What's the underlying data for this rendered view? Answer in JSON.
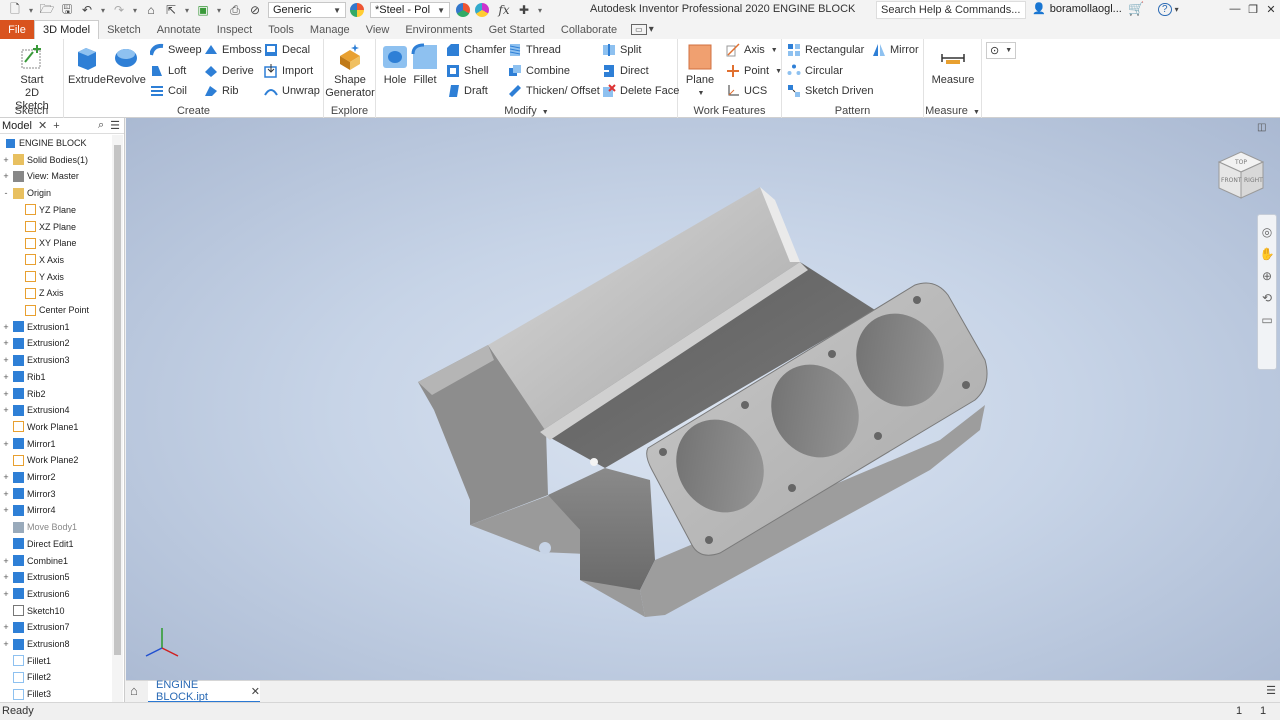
{
  "titlebar": {
    "appearance_dropdown": "Generic",
    "material_dropdown": "*Steel - Pol",
    "fx_label": "fx",
    "app_title": "Autodesk Inventor Professional 2020   ENGINE BLOCK",
    "search_label": "Search Help & Commands...",
    "user_name": "boramollaogl...",
    "help_label": "?"
  },
  "tabs": [
    "File",
    "3D Model",
    "Sketch",
    "Annotate",
    "Inspect",
    "Tools",
    "Manage",
    "View",
    "Environments",
    "Get Started",
    "Collaborate"
  ],
  "active_tab": "3D Model",
  "ribbon": {
    "sketch": {
      "start_sketch": "Start\n2D Sketch",
      "start_line1": "Start",
      "start_line2": "2D Sketch",
      "label": "Sketch"
    },
    "create": {
      "extrude": "Extrude",
      "revolve": "Revolve",
      "sweep": "Sweep",
      "emboss": "Emboss",
      "decal": "Decal",
      "loft": "Loft",
      "derive": "Derive",
      "import": "Import",
      "coil": "Coil",
      "rib": "Rib",
      "unwrap": "Unwrap",
      "label": "Create"
    },
    "explore": {
      "shape_line1": "Shape",
      "shape_line2": "Generator",
      "label": "Explore"
    },
    "modify": {
      "hole": "Hole",
      "fillet": "Fillet",
      "chamfer": "Chamfer",
      "thread": "Thread",
      "split": "Split",
      "shell": "Shell",
      "combine": "Combine",
      "direct": "Direct",
      "draft": "Draft",
      "thicken": "Thicken/ Offset",
      "delete_face": "Delete Face",
      "label": "Modify"
    },
    "work_features": {
      "plane": "Plane",
      "axis": "Axis",
      "point": "Point",
      "ucs": "UCS",
      "label": "Work Features"
    },
    "pattern": {
      "rectangular": "Rectangular",
      "mirror": "Mirror",
      "circular": "Circular",
      "sketch_driven": "Sketch Driven",
      "label": "Pattern"
    },
    "measure": {
      "measure": "Measure",
      "label": "Measure"
    }
  },
  "browser": {
    "title": "Model",
    "close": "✕",
    "add": "+",
    "root": "ENGINE BLOCK",
    "nodes": [
      {
        "label": "Solid Bodies(1)",
        "toggle": "+",
        "icon": "folder"
      },
      {
        "label": "View: Master",
        "toggle": "+",
        "icon": "view"
      },
      {
        "label": "Origin",
        "toggle": "-",
        "icon": "folder"
      },
      {
        "label": "YZ Plane",
        "toggle": "",
        "icon": "plane",
        "child": true
      },
      {
        "label": "XZ Plane",
        "toggle": "",
        "icon": "plane",
        "child": true
      },
      {
        "label": "XY Plane",
        "toggle": "",
        "icon": "plane",
        "child": true
      },
      {
        "label": "X Axis",
        "toggle": "",
        "icon": "axis",
        "child": true
      },
      {
        "label": "Y Axis",
        "toggle": "",
        "icon": "axis",
        "child": true
      },
      {
        "label": "Z Axis",
        "toggle": "",
        "icon": "axis",
        "child": true
      },
      {
        "label": "Center Point",
        "toggle": "",
        "icon": "point",
        "child": true
      },
      {
        "label": "Extrusion1",
        "toggle": "+",
        "icon": "extrude"
      },
      {
        "label": "Extrusion2",
        "toggle": "+",
        "icon": "extrude"
      },
      {
        "label": "Extrusion3",
        "toggle": "+",
        "icon": "extrude"
      },
      {
        "label": "Rib1",
        "toggle": "+",
        "icon": "rib"
      },
      {
        "label": "Rib2",
        "toggle": "+",
        "icon": "rib"
      },
      {
        "label": "Extrusion4",
        "toggle": "+",
        "icon": "extrude"
      },
      {
        "label": "Work Plane1",
        "toggle": "",
        "icon": "plane"
      },
      {
        "label": "Mirror1",
        "toggle": "+",
        "icon": "mirror"
      },
      {
        "label": "Work Plane2",
        "toggle": "",
        "icon": "plane"
      },
      {
        "label": "Mirror2",
        "toggle": "+",
        "icon": "mirror"
      },
      {
        "label": "Mirror3",
        "toggle": "+",
        "icon": "mirror"
      },
      {
        "label": "Mirror4",
        "toggle": "+",
        "icon": "mirror"
      },
      {
        "label": "Move Body1",
        "toggle": "",
        "icon": "move",
        "muted": true
      },
      {
        "label": "Direct Edit1",
        "toggle": "",
        "icon": "direct"
      },
      {
        "label": "Combine1",
        "toggle": "+",
        "icon": "combine"
      },
      {
        "label": "Extrusion5",
        "toggle": "+",
        "icon": "extrude"
      },
      {
        "label": "Extrusion6",
        "toggle": "+",
        "icon": "extrude"
      },
      {
        "label": "Sketch10",
        "toggle": "",
        "icon": "sketch"
      },
      {
        "label": "Extrusion7",
        "toggle": "+",
        "icon": "extrude"
      },
      {
        "label": "Extrusion8",
        "toggle": "+",
        "icon": "extrude"
      },
      {
        "label": "Fillet1",
        "toggle": "",
        "icon": "fillet"
      },
      {
        "label": "Fillet2",
        "toggle": "",
        "icon": "fillet"
      },
      {
        "label": "Fillet3",
        "toggle": "",
        "icon": "fillet"
      }
    ]
  },
  "viewcube": {
    "top": "TOP",
    "front": "FRONT",
    "right": "RIGHT"
  },
  "doc_tab": {
    "name": "ENGINE BLOCK.ipt",
    "close": "✕"
  },
  "status": {
    "text": "Ready",
    "count1": "1",
    "count2": "1"
  },
  "colors": {
    "accent": "#2a78d3",
    "file_tab": "#d9531e",
    "model_steel": "#8f8f8f"
  }
}
